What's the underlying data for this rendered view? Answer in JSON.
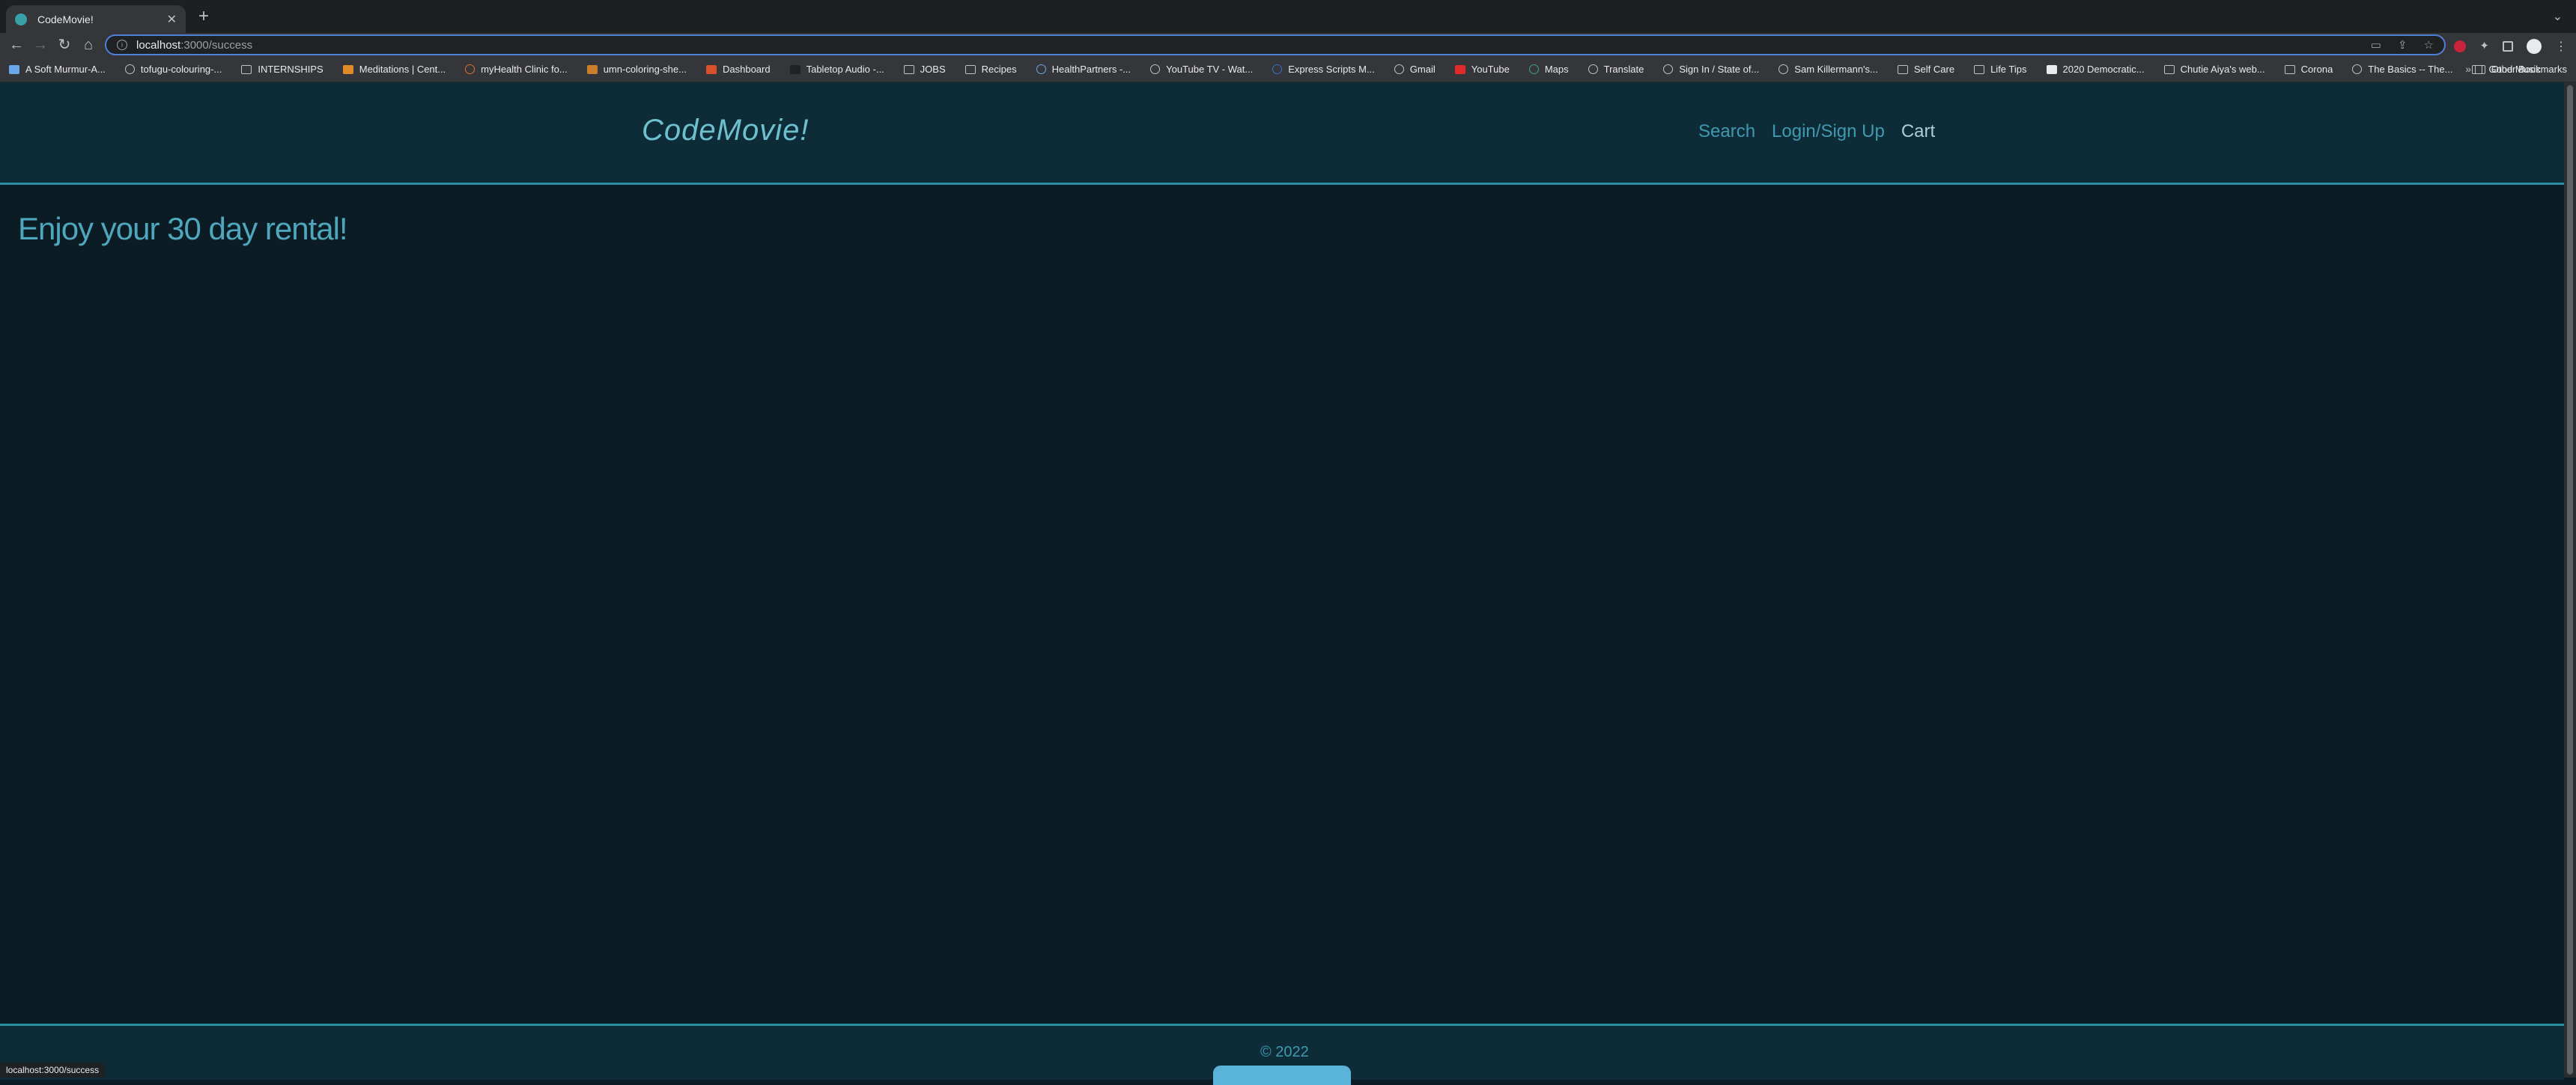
{
  "browser": {
    "tab": {
      "title": "CodeMovie!"
    },
    "url": {
      "host": "localhost",
      "rest": ":3000/success"
    },
    "bookmarks": [
      "A Soft Murmur-A...",
      "tofugu-colouring-...",
      "INTERNSHIPS",
      "Meditations | Cent...",
      "myHealth Clinic fo...",
      "umn-coloring-she...",
      "Dashboard",
      "Tabletop Audio -...",
      "JOBS",
      "Recipes",
      "HealthPartners -...",
      "YouTube TV - Wat...",
      "Express Scripts M...",
      "Gmail",
      "YouTube",
      "Maps",
      "Translate",
      "Sign In / State of...",
      "Sam Killermann's...",
      "Self Care",
      "Life Tips",
      "2020 Democratic...",
      "Chutie Aiya's web...",
      "Corona",
      "The Basics -- The...",
      "Good Music"
    ],
    "other_bookmarks": "Other Bookmarks",
    "status_url": "localhost:3000/success"
  },
  "site": {
    "brand": "CodeMovie!",
    "nav": {
      "search": "Search",
      "login": "Login/Sign Up",
      "cart": "Cart"
    },
    "heading": "Enjoy your 30 day rental!",
    "footer": {
      "copyright": "© 2022"
    }
  }
}
